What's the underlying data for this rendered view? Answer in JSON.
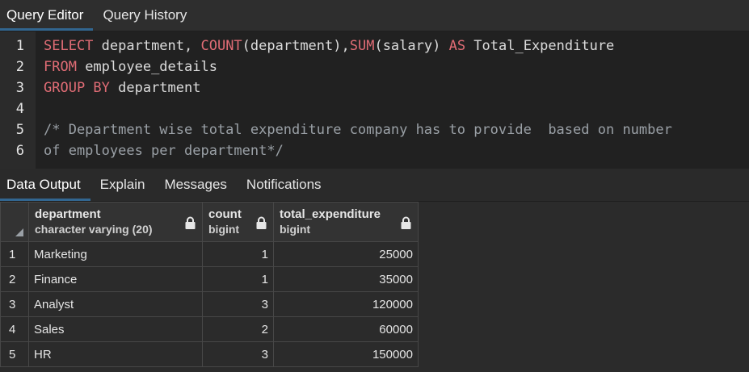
{
  "top_tabs": [
    {
      "label": "Query Editor",
      "active": true
    },
    {
      "label": "Query History",
      "active": false
    }
  ],
  "editor": {
    "lines": [
      {
        "num": "1",
        "parts": [
          {
            "t": "SELECT",
            "k": "kw"
          },
          {
            "t": " department, ",
            "k": ""
          },
          {
            "t": "COUNT",
            "k": "kw"
          },
          {
            "t": "(department),",
            "k": ""
          },
          {
            "t": "SUM",
            "k": "kw"
          },
          {
            "t": "(salary) ",
            "k": ""
          },
          {
            "t": "AS",
            "k": "kw"
          },
          {
            "t": " Total_Expenditure",
            "k": ""
          }
        ]
      },
      {
        "num": "2",
        "parts": [
          {
            "t": "FROM",
            "k": "kw"
          },
          {
            "t": " employee_details",
            "k": ""
          }
        ]
      },
      {
        "num": "3",
        "parts": [
          {
            "t": "GROUP BY",
            "k": "kw"
          },
          {
            "t": " department",
            "k": ""
          }
        ]
      },
      {
        "num": "4",
        "parts": []
      },
      {
        "num": "5",
        "parts": [
          {
            "t": "/* Department wise total expenditure company has to provide  based on number",
            "k": "cm"
          }
        ]
      },
      {
        "num": "6",
        "parts": [
          {
            "t": "of employees per department*/",
            "k": "cm"
          }
        ]
      }
    ]
  },
  "output_tabs": [
    {
      "label": "Data Output",
      "active": true
    },
    {
      "label": "Explain",
      "active": false
    },
    {
      "label": "Messages",
      "active": false
    },
    {
      "label": "Notifications",
      "active": false
    }
  ],
  "grid": {
    "columns": [
      {
        "name": "department",
        "type": "character varying (20)",
        "align": "txt"
      },
      {
        "name": "count",
        "type": "bigint",
        "align": "num"
      },
      {
        "name": "total_expenditure",
        "type": "bigint",
        "align": "num"
      }
    ],
    "rows": [
      {
        "n": "1",
        "cells": [
          "Marketing",
          "1",
          "25000"
        ]
      },
      {
        "n": "2",
        "cells": [
          "Finance",
          "1",
          "35000"
        ]
      },
      {
        "n": "3",
        "cells": [
          "Analyst",
          "3",
          "120000"
        ]
      },
      {
        "n": "4",
        "cells": [
          "Sales",
          "2",
          "60000"
        ]
      },
      {
        "n": "5",
        "cells": [
          "HR",
          "3",
          "150000"
        ]
      }
    ]
  },
  "colors": {
    "keyword": "#e06c75",
    "comment": "#9aa0a6",
    "active_tab_underline": "#326690"
  },
  "icons": {
    "column_lock": "lock-icon",
    "select_all": "corner-triangle-icon"
  }
}
